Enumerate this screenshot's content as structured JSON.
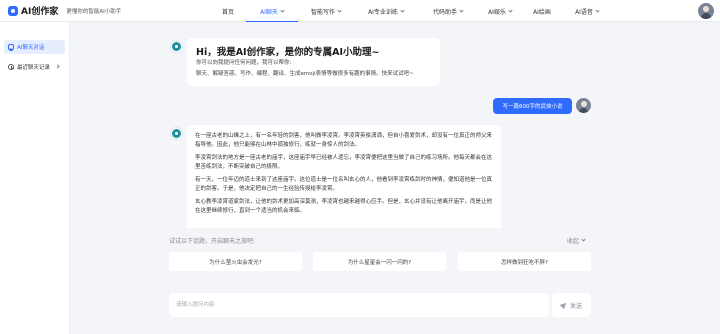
{
  "header": {
    "logo_text": "AI创作家",
    "slogan": "更懂你的智能AI小助手",
    "nav": [
      {
        "label": "首页",
        "dropdown": false,
        "active": false
      },
      {
        "label": "AI聊天",
        "dropdown": true,
        "active": true
      },
      {
        "label": "智能写作",
        "dropdown": true,
        "active": false
      },
      {
        "label": "AI专业训练",
        "dropdown": true,
        "active": false
      },
      {
        "label": "代码助手",
        "dropdown": true,
        "active": false
      },
      {
        "label": "AI娱乐",
        "dropdown": true,
        "active": false
      },
      {
        "label": "AI绘画",
        "dropdown": false,
        "active": false
      },
      {
        "label": "AI语音",
        "dropdown": true,
        "active": false
      }
    ]
  },
  "sidebar": {
    "items": [
      {
        "label": "AI聊天对话",
        "icon": "chat-icon",
        "active": true
      },
      {
        "label": "最近聊天记录",
        "icon": "clock-icon",
        "active": false
      }
    ]
  },
  "welcome": {
    "title": "Hi，我是AI创作家，是你的专属AI小助理~",
    "subtitle": "你可以向我提问任何问题，我可以帮你:",
    "capabilities": "聊天、解疑答惑、写作、编程、翻译、生成emoji表情等做很多有趣的事情。快来试试吧~"
  },
  "user_message": "写一篇600字的武侠小说",
  "story_paragraphs": [
    "在一座古老的山峰之上，有一名年轻的剑客，他叫做李凌霄。李凌霄英俊潇洒，但自小喜爱剑术，却没有一位真正的师父来指导他。因此，他只能够在山林中孤独修行，练就一身惊人的剑法。",
    "李凌霄剑法的地方是一座古老的庙宇，这座庙宇早已经被人遗忘，李凌霄便把这里当做了自己的练习场所。他每天都会在这里苦练剑法，不断突破自己的极限。",
    "有一天，一位年迈的道士来到了这座庙宇。这位道士是一位名叫玄心的人，他看到李凌霄练剑时的神情，便知道他是一位真正的剑客。于是，他决定把自己的一生经验传授给李凌霄。",
    "玄心教李凌霄道家剑法，让他的剑术更加高深莫测，李凌霄也越来越得心应手。但是，玄心并没有让他离开庙宇，而是让他在这里继续修行，直到一个适当的机会来临。"
  ],
  "suggestions": {
    "hint": "试试以下话题，开启聊天之旅吧:",
    "collapse_label": "收起",
    "items": [
      "为什么萤火虫会发光?",
      "为什么星星会一闪一闪的?",
      "怎样做到狂吃不胖?"
    ]
  },
  "composer": {
    "placeholder": "请输入提问内容",
    "send_label": "发送"
  }
}
